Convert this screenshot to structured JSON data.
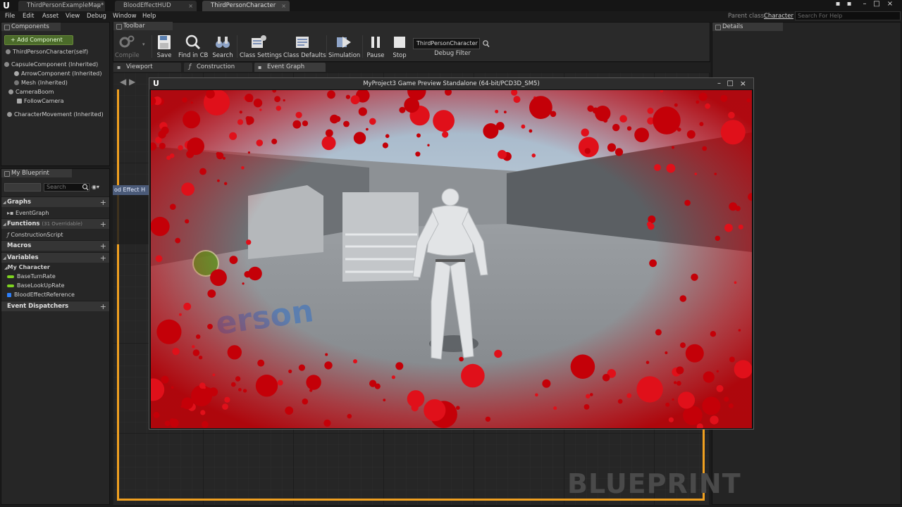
{
  "tabs": [
    {
      "label": "ThirdPersonExampleMap*"
    },
    {
      "label": "BloodEffectHUD"
    },
    {
      "label": "ThirdPersonCharacter"
    }
  ],
  "menu": [
    "File",
    "Edit",
    "Asset",
    "View",
    "Debug",
    "Window",
    "Help"
  ],
  "parent_class": {
    "label": "Parent class:",
    "value": "Character"
  },
  "help_search_placeholder": "Search For Help",
  "components": {
    "tab": "Components",
    "add_button": "+ Add Component",
    "items": [
      "ThirdPersonCharacter(self)",
      "CapsuleComponent (Inherited)",
      "ArrowComponent (Inherited)",
      "Mesh (Inherited)",
      "CameraBoom",
      "FollowCamera",
      "CharacterMovement (Inherited)"
    ]
  },
  "my_blueprint": {
    "tab": "My Blueprint",
    "search_placeholder": "Search",
    "graphs": {
      "title": "Graphs",
      "items": [
        "EventGraph"
      ]
    },
    "functions": {
      "title": "Functions",
      "count": "(31 Overridable)",
      "items": [
        "ConstructionScript"
      ]
    },
    "macros": {
      "title": "Macros"
    },
    "variables": {
      "title": "Variables",
      "category": "My Character",
      "items": [
        {
          "name": "BaseTurnRate",
          "color": "#7ed321"
        },
        {
          "name": "BaseLookUpRate",
          "color": "#7ed321"
        },
        {
          "name": "BloodEffectReference",
          "color": "#2d7ff9"
        }
      ]
    },
    "dispatchers": {
      "title": "Event Dispatchers"
    }
  },
  "toolbar": {
    "tab": "Toolbar",
    "compile": "Compile",
    "save": "Save",
    "find": "Find in CB",
    "search": "Search",
    "class_settings": "Class Settings",
    "class_defaults": "Class Defaults",
    "simulation": "Simulation",
    "pause": "Pause",
    "stop": "Stop",
    "debug_object": "ThirdPersonCharacter",
    "debug_filter": "Debug Filter"
  },
  "details": {
    "tab": "Details"
  },
  "editor_tabs": [
    {
      "label": "Viewport"
    },
    {
      "label": "Construction Script"
    },
    {
      "label": "Event Graph"
    }
  ],
  "graph": {
    "watermark": "BLUEPRINT",
    "node_fragment": "od Effect H",
    "floor_text": "erson"
  },
  "game_window": {
    "title": "MyProject3 Game Preview Standalone (64-bit/PCD3D_SM5)"
  },
  "colors": {
    "accent": "#f0a020",
    "blood": "#c40008"
  }
}
